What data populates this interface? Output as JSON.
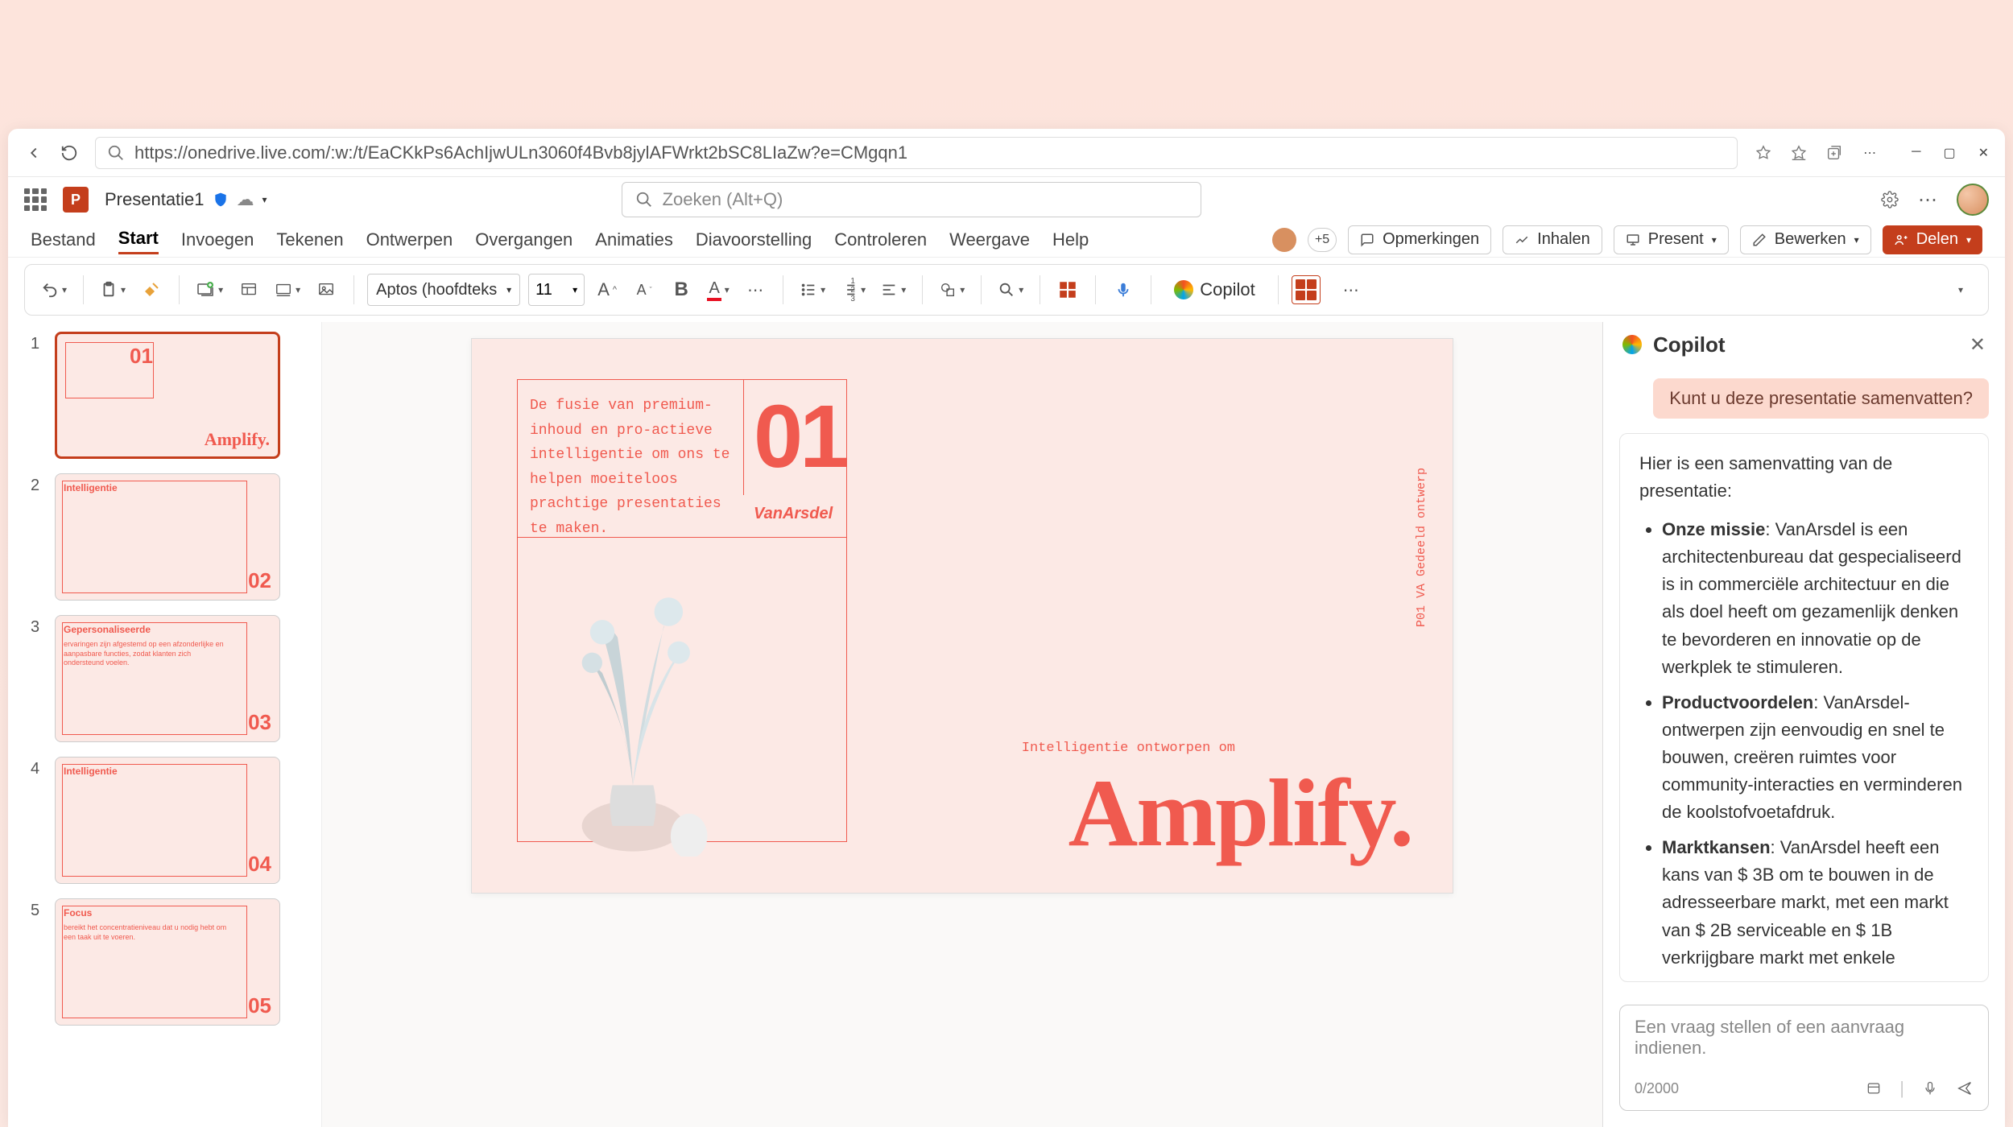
{
  "browser": {
    "url": "https://onedrive.live.com/:w:/t/EaCKkPs6AchIjwULn3060f4Bvb8jylAFWrkt2bSC8LIaZw?e=CMgqn1"
  },
  "header": {
    "doc_title": "Presentatie1",
    "search_placeholder": "Zoeken (Alt+Q)"
  },
  "tabs": {
    "bestand": "Bestand",
    "start": "Start",
    "invoegen": "Invoegen",
    "tekenen": "Tekenen",
    "ontwerpen": "Ontwerpen",
    "overgangen": "Overgangen",
    "animaties": "Animaties",
    "diavoorstelling": "Diavoorstelling",
    "controleren": "Controleren",
    "weergave": "Weergave",
    "help": "Help"
  },
  "actions": {
    "plus5": "+5",
    "opmerkingen": "Opmerkingen",
    "inhalen": "Inhalen",
    "present": "Present",
    "bewerken": "Bewerken",
    "delen": "Delen"
  },
  "toolbar": {
    "font": "Aptos (hoofdteks",
    "size": "11",
    "bold": "B",
    "copilot": "Copilot"
  },
  "thumbs": [
    {
      "num": "1",
      "bignum": "01",
      "amplify": "Amplify.",
      "heading": "",
      "body": ""
    },
    {
      "num": "2",
      "bignum": "02",
      "amplify": "",
      "heading": "Intelligentie",
      "body": ""
    },
    {
      "num": "3",
      "bignum": "03",
      "amplify": "",
      "heading": "Gepersonaliseerde",
      "body": "ervaringen zijn afgestemd op een afzonderlijke en aanpasbare functies, zodat klanten zich ondersteund voelen."
    },
    {
      "num": "4",
      "bignum": "04",
      "amplify": "",
      "heading": "Intelligentie",
      "body": ""
    },
    {
      "num": "5",
      "bignum": "05",
      "amplify": "",
      "heading": "Focus",
      "body": "bereikt het concentratieniveau dat u nodig hebt om een taak uit te voeren."
    }
  ],
  "slide": {
    "desc": "De fusie van premium-inhoud en pro-actieve intelligentie om ons te helpen moeiteloos prachtige presentaties te maken.",
    "bignum": "01",
    "brand": "VanArsdel",
    "subtitle": "Intelligentie ontworpen om",
    "amplify": "Amplify.",
    "sidetext": "P01   VA  Gedeeld ontwerp"
  },
  "copilot": {
    "title": "Copilot",
    "user_msg": "Kunt u deze presentatie samenvatten?",
    "intro": "Hier is een samenvatting van de presentatie:",
    "b1_label": "Onze missie",
    "b1_text": ": VanArsdel is een architectenbureau dat gespecialiseerd is in commerciële architectuur en die als doel heeft om gezamenlijk denken te bevorderen en innovatie op de werkplek te stimuleren.",
    "b2_label": "Productvoordelen",
    "b2_text": ": VanArsdel-ontwerpen zijn eenvoudig en snel te bouwen, creëren ruimtes voor community-interacties en verminderen de koolstofvoetafdruk.",
    "b3_label": "Marktkansen",
    "b3_text": ": VanArsdel heeft een kans van $ 3B om te bouwen in de adresseerbare markt, met een markt van $ 2B serviceable en $ 1B verkrijgbare markt met enkele",
    "input_placeholder": "Een vraag stellen of een aanvraag indienen.",
    "counter": "0/2000"
  }
}
